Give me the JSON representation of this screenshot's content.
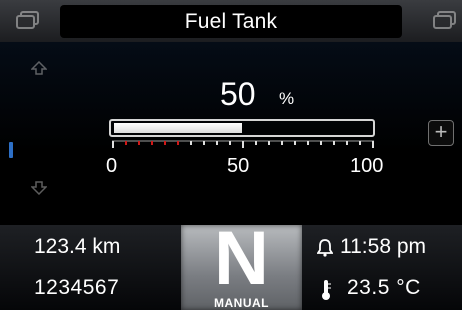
{
  "header": {
    "title": "Fuel Tank",
    "left_icon": "window-icon",
    "right_icon": "window-icon"
  },
  "fuel": {
    "value": "50",
    "unit": "%",
    "level_percent": 50,
    "scale_labels": [
      "0",
      "50",
      "100"
    ],
    "plus_label": "+"
  },
  "status": {
    "odometer": "123.4 km",
    "total": "1234567",
    "gear": "N",
    "gear_mode": "MANUAL",
    "time": "11:58 pm",
    "temperature": "23.5 °C"
  },
  "colors": {
    "accent": "#2d6fc6",
    "warning_ticks": "#d01818"
  }
}
